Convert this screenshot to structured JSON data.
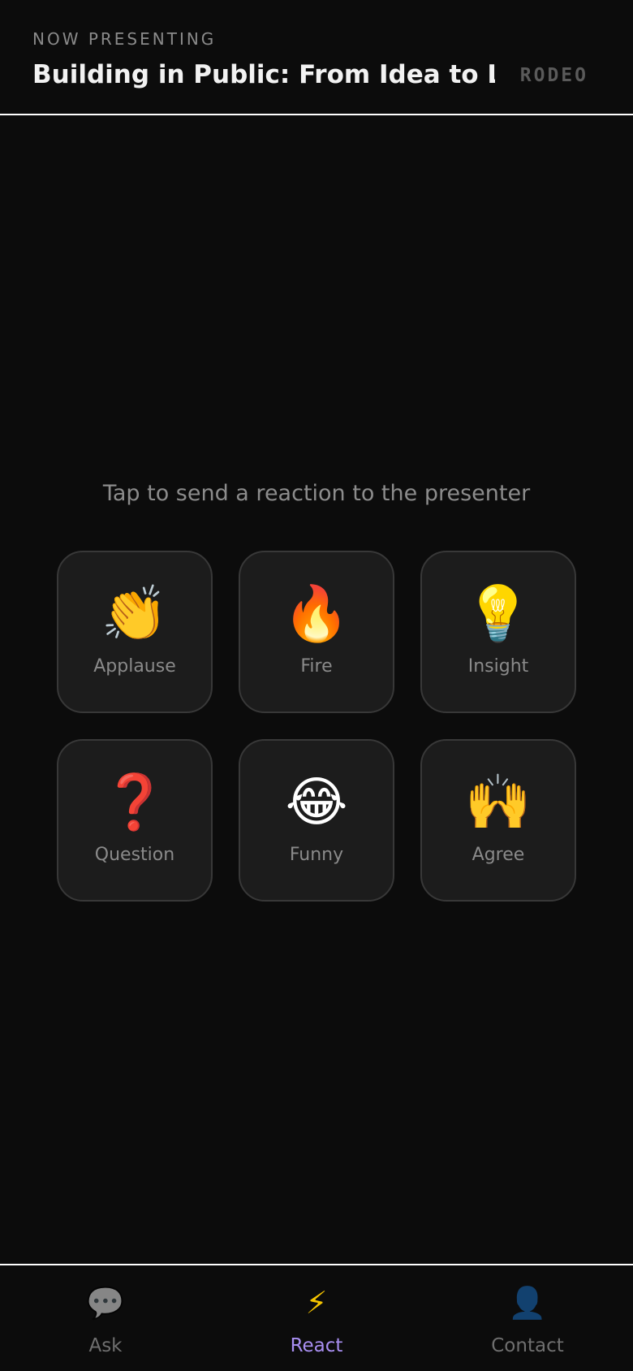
{
  "header": {
    "eyebrow": "NOW PRESENTING",
    "title": "Building in Public: From Idea to Lau...",
    "brand": "RODEO"
  },
  "main": {
    "instruction": "Tap to send a reaction to the presenter",
    "reactions": [
      {
        "emoji": "👏",
        "label": "Applause",
        "icon": "clapping-hands-icon"
      },
      {
        "emoji": "🔥",
        "label": "Fire",
        "icon": "fire-icon"
      },
      {
        "emoji": "💡",
        "label": "Insight",
        "icon": "light-bulb-icon"
      },
      {
        "emoji": "❓",
        "label": "Question",
        "icon": "question-mark-icon"
      },
      {
        "emoji": "😂",
        "label": "Funny",
        "icon": "laughing-face-icon"
      },
      {
        "emoji": "🙌",
        "label": "Agree",
        "icon": "raised-hands-icon"
      }
    ]
  },
  "tabbar": {
    "tabs": [
      {
        "icon": "💬",
        "label": "Ask",
        "icon_name": "speech-bubble-icon",
        "active": false
      },
      {
        "icon": "⚡",
        "label": "React",
        "icon_name": "lightning-icon",
        "active": true
      },
      {
        "icon": "👤",
        "label": "Contact",
        "icon_name": "person-icon",
        "active": false
      }
    ]
  },
  "colors": {
    "background": "#0c0c0c",
    "card": "#1c1c1c",
    "card_border": "#383838",
    "active_tab": "#a98ff2",
    "muted_text": "#8a8a8a"
  }
}
